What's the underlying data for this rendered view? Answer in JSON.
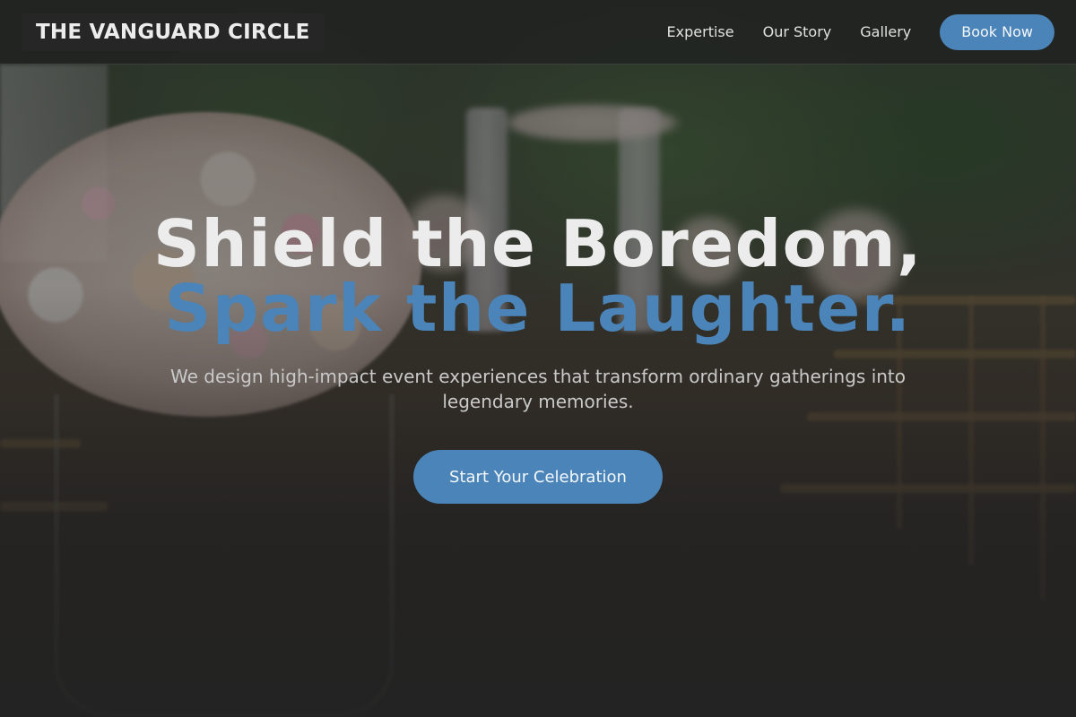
{
  "nav": {
    "brand": "THE VANGUARD CIRCLE",
    "links": [
      "Expertise",
      "Our Story",
      "Gallery"
    ],
    "book_label": "Book Now"
  },
  "hero": {
    "headline_line1": "Shield the Boredom,",
    "headline_line2": "Spark the Laughter.",
    "subtitle": "We design high-impact event experiences that transform ordinary gatherings into legendary memories.",
    "cta_label": "Start Your Celebration"
  },
  "colors": {
    "accent": "#4a84b8",
    "background": "#232323",
    "text": "#ececec"
  }
}
